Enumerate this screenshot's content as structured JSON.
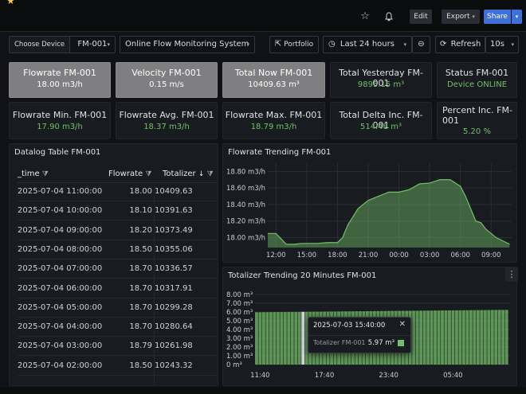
{
  "topbar": {
    "star_glyph": "★",
    "edit": "Edit",
    "export": "Export",
    "share": "Share",
    "caret": "▾"
  },
  "controls": {
    "device_label": "Choose Device",
    "device_value": "FM-001",
    "system_value": "Online Flow Monitoring System",
    "portfolio": "Portfolio",
    "time_range": "Last 24 hours",
    "refresh": "Refresh",
    "refresh_interval": "10s"
  },
  "stats_row1": [
    {
      "title": "Flowrate FM-001",
      "value": "18.00 m3/h"
    },
    {
      "title": "Velocity FM-001",
      "value": "0.15 m/s"
    },
    {
      "title": "Total Now FM-001",
      "value": "10409.63 m³"
    },
    {
      "title": "Total Yesterday FM-001",
      "value": "9895.15 m³"
    },
    {
      "title": "Status FM-001",
      "value": "Device ONLINE"
    }
  ],
  "stats_row2": [
    {
      "title": "Flowrate Min. FM-001",
      "value": "17.90 m3/h"
    },
    {
      "title": "Flowrate Avg. FM-001",
      "value": "18.37 m3/h"
    },
    {
      "title": "Flowrate Max. FM-001",
      "value": "18.79 m3/h"
    },
    {
      "title": "Total Delta Inc. FM-001",
      "value": "514.48 m³"
    },
    {
      "title": "Percent Inc. FM-001",
      "value": "5.20 %"
    }
  ],
  "table": {
    "title": "Datalog Table FM-001",
    "headers": [
      "_time",
      "Flowrate",
      "Totalizer"
    ],
    "rows": [
      [
        "2025-07-04 11:00:00",
        "18.00",
        "10409.63"
      ],
      [
        "2025-07-04 10:00:00",
        "18.10",
        "10391.63"
      ],
      [
        "2025-07-04 09:00:00",
        "18.20",
        "10373.49"
      ],
      [
        "2025-07-04 08:00:00",
        "18.50",
        "10355.06"
      ],
      [
        "2025-07-04 07:00:00",
        "18.70",
        "10336.57"
      ],
      [
        "2025-07-04 06:00:00",
        "18.70",
        "10317.91"
      ],
      [
        "2025-07-04 05:00:00",
        "18.70",
        "10299.28"
      ],
      [
        "2025-07-04 04:00:00",
        "18.70",
        "10280.64"
      ],
      [
        "2025-07-04 03:00:00",
        "18.79",
        "10261.98"
      ],
      [
        "2025-07-04 02:00:00",
        "18.50",
        "10243.32"
      ]
    ]
  },
  "tooltip": {
    "time": "2025-07-03 15:40:00",
    "close": "✕",
    "series": "Totalizer FM-001",
    "value": "5.97 m³"
  },
  "colors": {
    "green": "#73bf69",
    "blue": "#3d71d9",
    "highlight": "#7f7f81"
  },
  "chart_data": [
    {
      "type": "area",
      "title": "Flowrate Trending FM-001",
      "y_ticks": [
        "18.80 m3/h",
        "18.60 m3/h",
        "18.40 m3/h",
        "18.20 m3/h",
        "18.00 m3/h"
      ],
      "ylim": [
        17.88,
        18.9
      ],
      "x_ticks": [
        "12:00",
        "15:00",
        "18:00",
        "21:00",
        "00:00",
        "03:00",
        "06:00",
        "09:00"
      ],
      "x_hours": [
        11.2,
        12,
        13,
        13.8,
        14.5,
        15,
        16,
        17,
        18,
        18.5,
        19,
        19.5,
        20,
        21,
        22,
        23,
        24,
        25,
        26,
        27,
        28,
        29,
        30,
        30.5,
        31,
        31.5,
        32,
        32.5,
        33,
        33.5,
        34.8
      ],
      "series": [
        {
          "values": [
            18.05,
            18.05,
            17.92,
            17.92,
            17.93,
            17.93,
            17.93,
            17.94,
            17.94,
            18.0,
            18.15,
            18.25,
            18.35,
            18.45,
            18.5,
            18.55,
            18.55,
            18.58,
            18.65,
            18.66,
            18.7,
            18.7,
            18.62,
            18.5,
            18.35,
            18.2,
            18.18,
            18.1,
            18.05,
            18.0,
            17.92
          ]
        }
      ]
    },
    {
      "type": "bar",
      "title": "Totalizer Trending 20 Minutes FM-001",
      "y_ticks": [
        "8.00 m³",
        "7.00 m³",
        "6.00 m³",
        "5.00 m³",
        "4.00 m³",
        "3.00 m³",
        "2.00 m³",
        "1.00 m³",
        "0 m³"
      ],
      "ylim": [
        0,
        8
      ],
      "x_ticks": [
        "11:40",
        "17:40",
        "23:40",
        "05:40"
      ],
      "x_hours": [
        11.67,
        17.67,
        23.67,
        29.67
      ],
      "xlim_hours": [
        11.2,
        35.0
      ],
      "interval_minutes": 20,
      "series": [
        {
          "name": "Totalizer FM-001",
          "start_value": 5.97,
          "end_value": 6.25
        }
      ]
    }
  ]
}
